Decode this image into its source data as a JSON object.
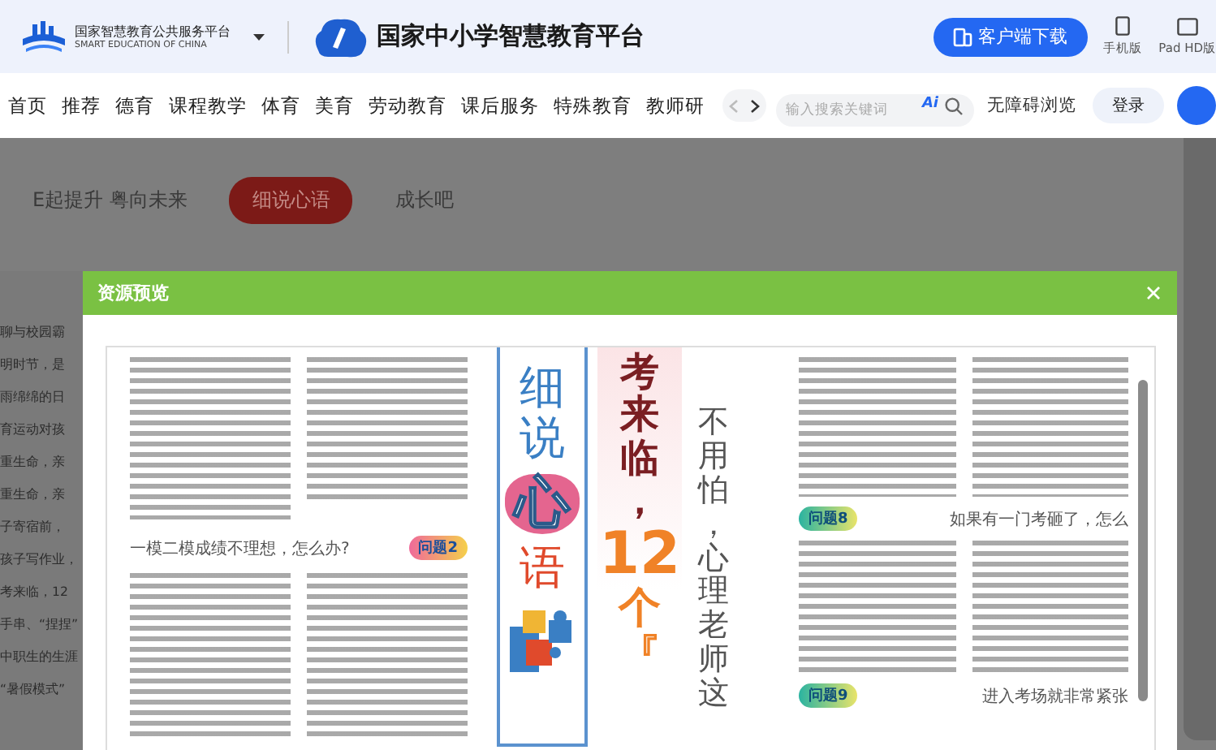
{
  "header": {
    "platform_name": "国家智慧教育公共服务平台",
    "platform_name_en": "SMART EDUCATION OF CHINA",
    "site_title": "国家中小学智慧教育平台",
    "download_button": "客户端下载",
    "devices": [
      {
        "kind": "phone",
        "label": "手机版"
      },
      {
        "kind": "tablet",
        "label": "Pad HD版"
      }
    ]
  },
  "nav": {
    "items": [
      "首页",
      "推荐",
      "德育",
      "课程教学",
      "体育",
      "美育",
      "劳动教育",
      "课后服务",
      "特殊教育",
      "教师研"
    ],
    "search": {
      "placeholder": "输入搜索关键词",
      "ai_label": "Ai"
    },
    "accessibility": "无障碍浏览",
    "login": "登录"
  },
  "background_page": {
    "tabs": [
      {
        "label": "E起提升 粤向未来",
        "selected": false
      },
      {
        "label": "细说心语",
        "selected": true
      },
      {
        "label": "成长吧",
        "selected": false
      }
    ],
    "articles": [
      "聊与校园霸",
      "明时节，是",
      "雨绵绵的日",
      "育运动对孩",
      "重生命，亲",
      "重生命，亲",
      "子寄宿前，",
      "孩子写作业，",
      "考来临，12",
      "手串、“捏捏”",
      "中职生的生涯",
      "“暑假模式”"
    ]
  },
  "modal": {
    "title": "资源预览",
    "document": {
      "left_heading": "一模二模成绩不理想，怎么办?",
      "left_badge": "问题2",
      "poster": {
        "strip": [
          {
            "text": "细说",
            "kind": "plain"
          },
          {
            "text": "心",
            "kind": "heart"
          },
          {
            "text": "语",
            "kind": "accent"
          }
        ],
        "title_top": "考来临，",
        "title_number": "12",
        "title_bottom": "个『",
        "subtitle": "不用怕，心理老师这"
      },
      "right_sections": [
        {
          "badge": "问题8",
          "heading": "如果有一门考砸了，怎么"
        },
        {
          "badge": "问题9",
          "heading": "进入考场就非常紧张"
        }
      ]
    }
  }
}
